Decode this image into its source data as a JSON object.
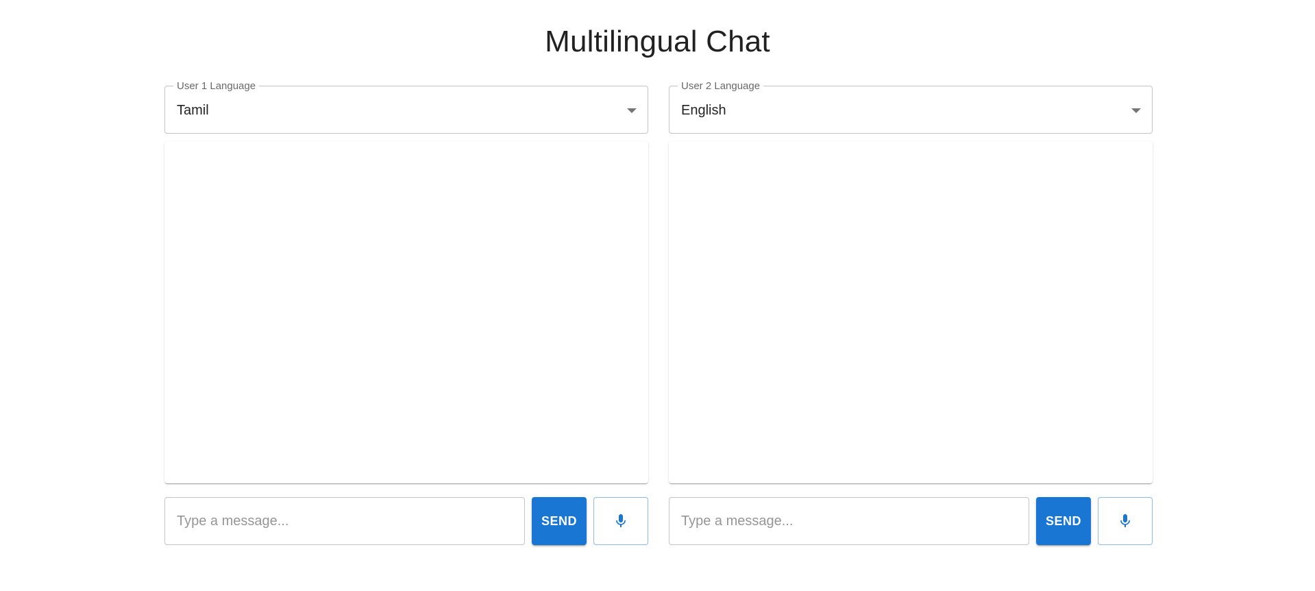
{
  "page": {
    "title": "Multilingual Chat"
  },
  "colors": {
    "primary": "#1976d2",
    "border": "#c4c4c4"
  },
  "user1": {
    "language_label": "User 1 Language",
    "language_value": "Tamil",
    "input_placeholder": "Type a message...",
    "send_label": "SEND",
    "mic_icon": "mic-icon"
  },
  "user2": {
    "language_label": "User 2 Language",
    "language_value": "English",
    "input_placeholder": "Type a message...",
    "send_label": "SEND",
    "mic_icon": "mic-icon"
  }
}
